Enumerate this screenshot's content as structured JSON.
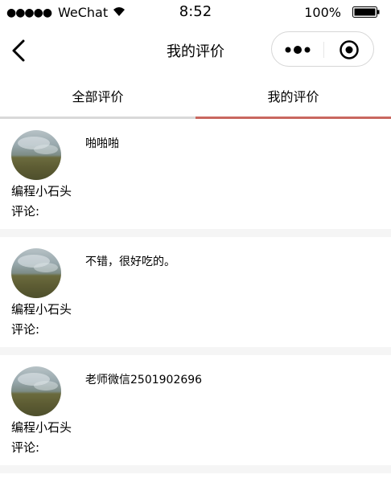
{
  "status_bar": {
    "signal": "●●●●●",
    "carrier": "WeChat",
    "time": "8:52",
    "battery_percent": "100%"
  },
  "nav": {
    "title": "我的评价"
  },
  "tabs": [
    {
      "label": "全部评价",
      "active": false
    },
    {
      "label": "我的评价",
      "active": true
    }
  ],
  "reviews": [
    {
      "username": "编程小石头",
      "comment_label": "评论:",
      "content": "啪啪啪"
    },
    {
      "username": "编程小石头",
      "comment_label": "评论:",
      "content": "不错，很好吃的。"
    },
    {
      "username": "编程小石头",
      "comment_label": "评论:",
      "content": "老师微信2501902696"
    }
  ],
  "colors": {
    "active_tab_underline": "#c9675f",
    "inactive_tab_underline": "#d9d9d9",
    "separator": "#f5f5f5"
  }
}
